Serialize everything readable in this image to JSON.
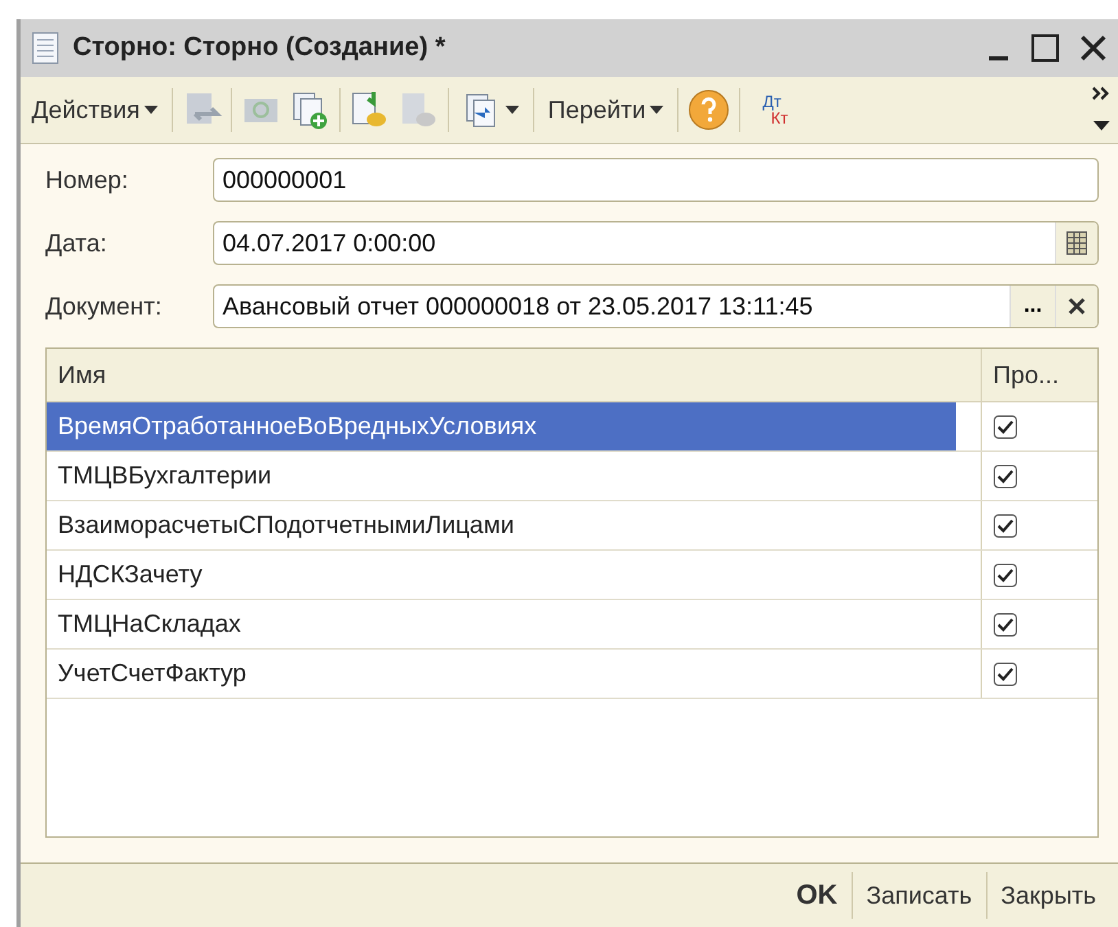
{
  "window": {
    "title": "Сторно: Сторно (Создание) *"
  },
  "toolbar": {
    "actions_menu": "Действия",
    "goto_menu": "Перейти",
    "dtkt": {
      "top": "Дт",
      "bottom": "Кт"
    }
  },
  "fields": [
    {
      "label": "Номер:",
      "value": "000000001",
      "kind": "text"
    },
    {
      "label": "Дата:",
      "value": "04.07.2017  0:00:00",
      "kind": "date"
    },
    {
      "label": "Документ:",
      "value": "Авансовый отчет 000000018 от 23.05.2017 13:11:45",
      "kind": "choice",
      "choice_button": "..."
    }
  ],
  "table": {
    "columns": [
      "Имя",
      "Про..."
    ],
    "rows": [
      {
        "name": "ВремяОтработанноеВоВредныхУсловиях",
        "checked": true,
        "selected": true
      },
      {
        "name": "ТМЦВБухгалтерии",
        "checked": true,
        "selected": false
      },
      {
        "name": "ВзаиморасчетыСПодотчетнымиЛицами",
        "checked": true,
        "selected": false
      },
      {
        "name": "НДСКЗачету",
        "checked": true,
        "selected": false
      },
      {
        "name": "ТМЦНаСкладах",
        "checked": true,
        "selected": false
      },
      {
        "name": "УчетСчетФактур",
        "checked": true,
        "selected": false
      }
    ]
  },
  "buttons": [
    {
      "label": "OK",
      "default": true
    },
    {
      "label": "Записать",
      "default": false
    },
    {
      "label": "Закрыть",
      "default": false
    }
  ]
}
